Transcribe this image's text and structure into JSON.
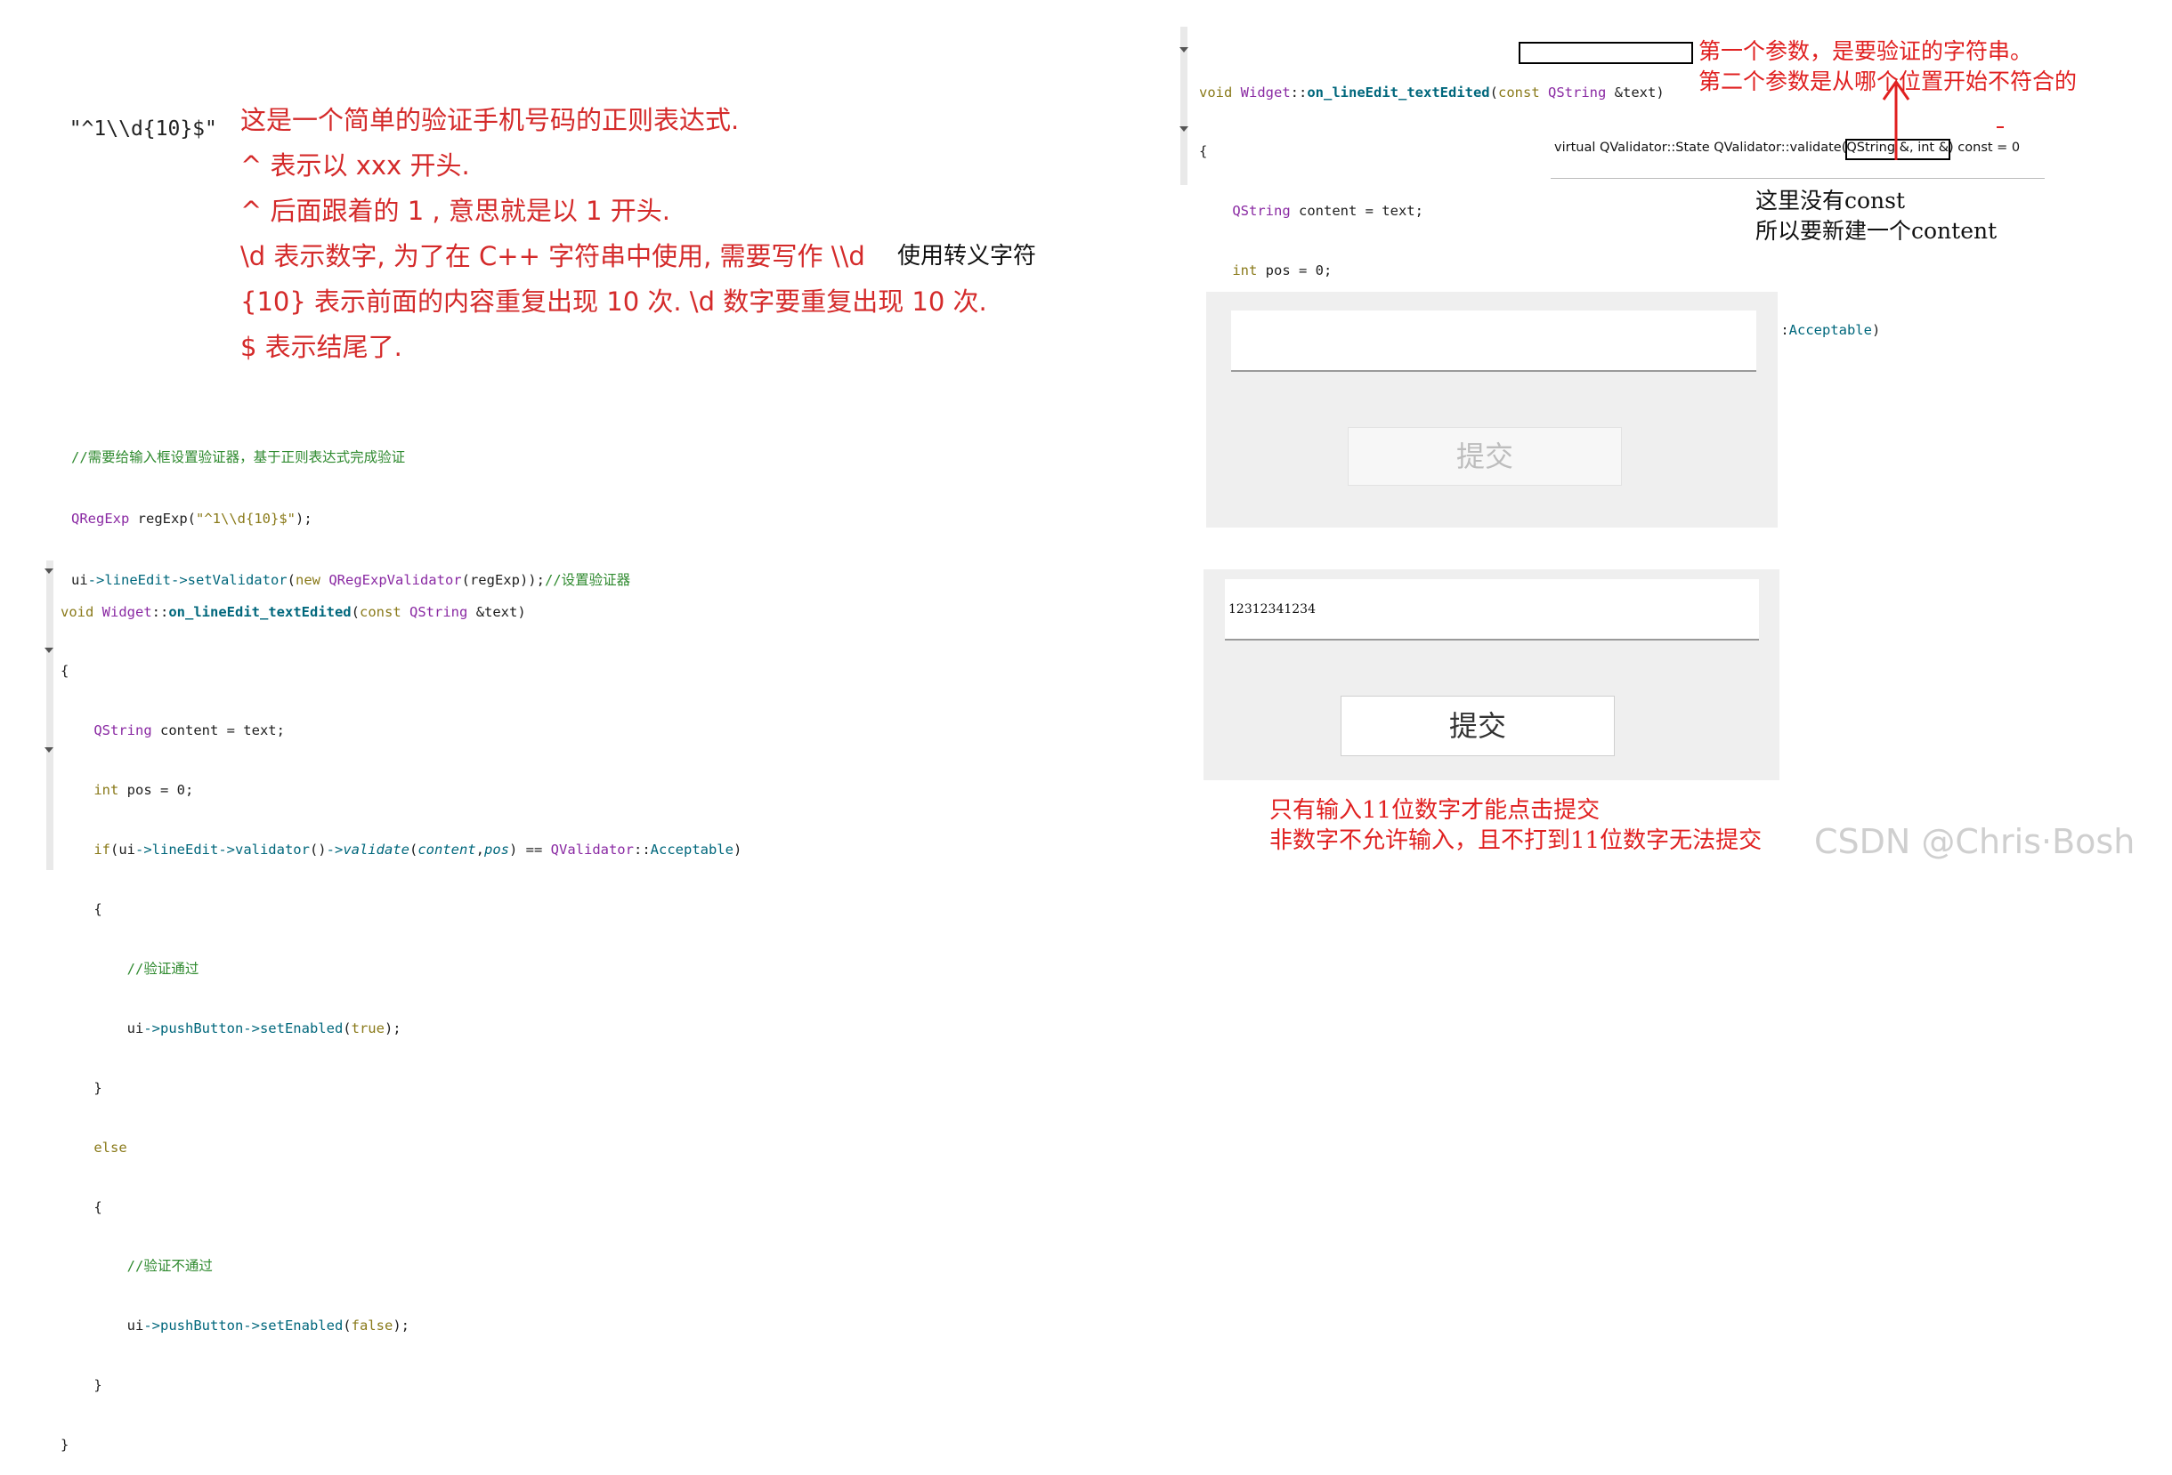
{
  "left_regex": {
    "literal": "\"^1\\\\d{10}$\"",
    "explain_lines": [
      "这是一个简单的验证手机号码的正则表达式.",
      "^ 表示以 xxx 开头.",
      "^ 后面跟着的 1 , 意思就是以 1 开头.",
      "\\d 表示数字, 为了在 C++ 字符串中使用, 需要写作 \\\\d",
      "{10} 表示前面的内容重复出现 10 次. \\d 数字要重复出现 10 次.",
      "$ 表示结尾了."
    ],
    "escape_note": "使用转义字符"
  },
  "validator_code": {
    "comment": "//需要给输入框设置验证器，基于正则表达式完成验证",
    "line2": "QRegExp regExp(\"^1\\\\d{10}$\");",
    "line3": "ui->lineEdit->setValidator(new QRegExpValidator(regExp));//设置验证器"
  },
  "slot_code_full": [
    "void Widget::on_lineEdit_textEdited(const QString &text)",
    "{",
    "    QString content = text;",
    "    int pos = 0;",
    "    if(ui->lineEdit->validator()->validate(content,pos) == QValidator::Acceptable)",
    "    {",
    "        //验证通过",
    "        ui->pushButton->setEnabled(true);",
    "    }",
    "    else",
    "    {",
    "        //验证不通过",
    "        ui->pushButton->setEnabled(false);",
    "    }",
    "}"
  ],
  "right_snippet": {
    "tooltip": "virtual QValidator::State QValidator::validate(QString &, int &) const = 0",
    "note_params_1": "第一个参数，是要验证的字符串。",
    "note_params_2": "第二个参数是从哪个位置开始不符合的",
    "note_const_1": "这里没有const",
    "note_const_2": "所以要新建一个content"
  },
  "demo_empty": {
    "input_value": "",
    "button_label": "提交",
    "button_enabled": false
  },
  "demo_filled": {
    "input_value": "12312341234",
    "button_label": "提交",
    "button_enabled": true
  },
  "bottom_notes": {
    "line1": "只有输入11位数字才能点击提交",
    "line2": "非数字不允许输入，且不打到11位数字无法提交"
  },
  "watermark": "CSDN @Chris·Bosh",
  "colors": {
    "annotation_red": "#e02020",
    "code_keyword": "#8a7a1a",
    "code_type": "#8a2aa3",
    "code_member": "#00677c",
    "code_comment": "#2f8a2f"
  }
}
